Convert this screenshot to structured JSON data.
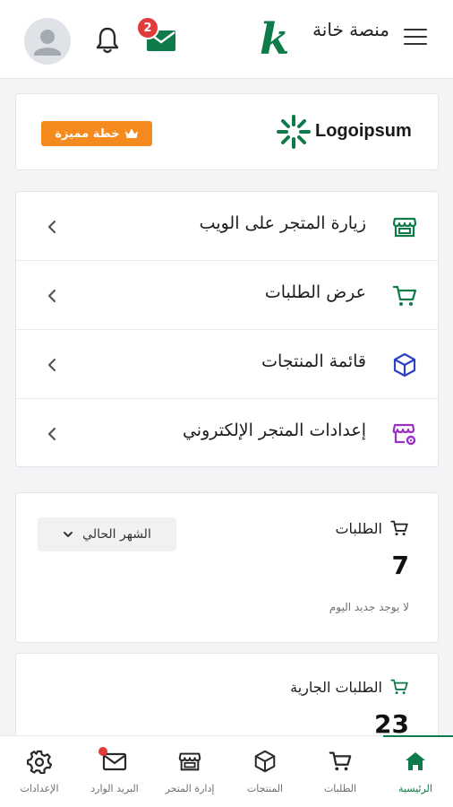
{
  "header": {
    "brand_letter": "k",
    "brand_name": "منصة خانة",
    "mail_badge_count": "2"
  },
  "plan": {
    "badge_label": "خطة مميزة",
    "logo_text": "Logoipsum"
  },
  "menu": {
    "items": [
      {
        "label": "زيارة المتجر على الويب",
        "icon": "storefront-icon",
        "color": "#0f7a4a"
      },
      {
        "label": "عرض الطلبات",
        "icon": "cart-icon",
        "color": "#0f7a4a"
      },
      {
        "label": "قائمة المنتجات",
        "icon": "box-icon",
        "color": "#2b3fc7"
      },
      {
        "label": "إعدادات المتجر الإلكتروني",
        "icon": "store-settings-icon",
        "color": "#9b2fc7"
      }
    ]
  },
  "orders": {
    "title": "الطلبات",
    "value": "7",
    "note": "لا يوجد جديد اليوم",
    "period_label": "الشهر الحالي"
  },
  "ongoing": {
    "title": "الطلبات الجارية",
    "value": "23"
  },
  "bottom_nav": {
    "items": [
      {
        "label": "الرئيسية",
        "icon": "home-icon",
        "active": true
      },
      {
        "label": "الطلبات",
        "icon": "cart-icon",
        "active": false
      },
      {
        "label": "المنتجات",
        "icon": "box-icon",
        "active": false
      },
      {
        "label": "إدارة المتجر",
        "icon": "storefront-icon",
        "active": false
      },
      {
        "label": "البريد الوارد",
        "icon": "mail-icon",
        "active": false
      },
      {
        "label": "الإعدادات",
        "icon": "gear-icon",
        "active": false
      }
    ]
  },
  "colors": {
    "brand_green": "#0f7a4a",
    "plan_orange": "#f58a1f",
    "badge_red": "#e23b3b"
  }
}
